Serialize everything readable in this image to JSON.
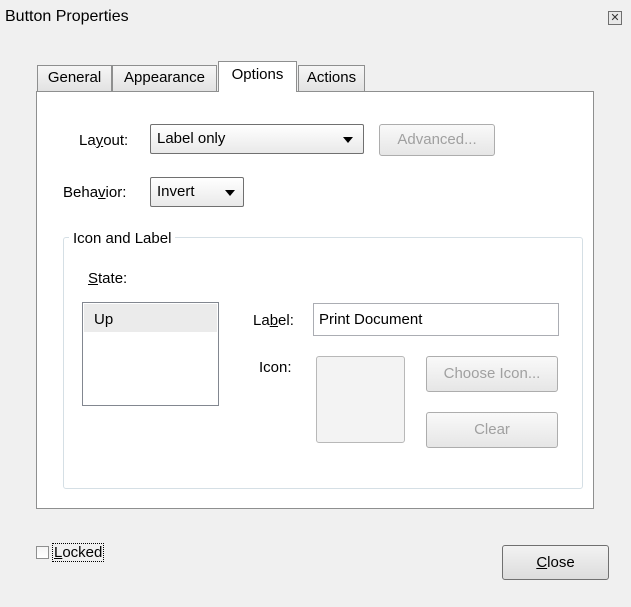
{
  "window": {
    "title": "Button Properties",
    "close_glyph": "✕"
  },
  "tabs": [
    {
      "label": "General",
      "active": false
    },
    {
      "label": "Appearance",
      "active": false
    },
    {
      "label": "Options",
      "active": true
    },
    {
      "label": "Actions",
      "active": false
    }
  ],
  "options": {
    "layout_label_pre": "La",
    "layout_label_mnemonic": "y",
    "layout_label_post": "out:",
    "layout_value": "Label only",
    "advanced_label": "Advanced...",
    "behavior_label_pre": "Beha",
    "behavior_label_mnemonic": "v",
    "behavior_label_post": "ior:",
    "behavior_value": "Invert"
  },
  "icon_label_group": {
    "title": "Icon and Label",
    "state_label_mnemonic": "S",
    "state_label_post": "tate:",
    "states": [
      "Up"
    ],
    "label_label_pre": "La",
    "label_label_mnemonic": "b",
    "label_label_post": "el:",
    "label_value": "Print Document",
    "icon_label": "Icon:",
    "choose_icon_label": "Choose Icon...",
    "clear_label": "Clear"
  },
  "footer": {
    "locked_mnemonic": "L",
    "locked_post": "ocked",
    "locked_checked": false,
    "close_mnemonic": "C",
    "close_post": "lose"
  }
}
